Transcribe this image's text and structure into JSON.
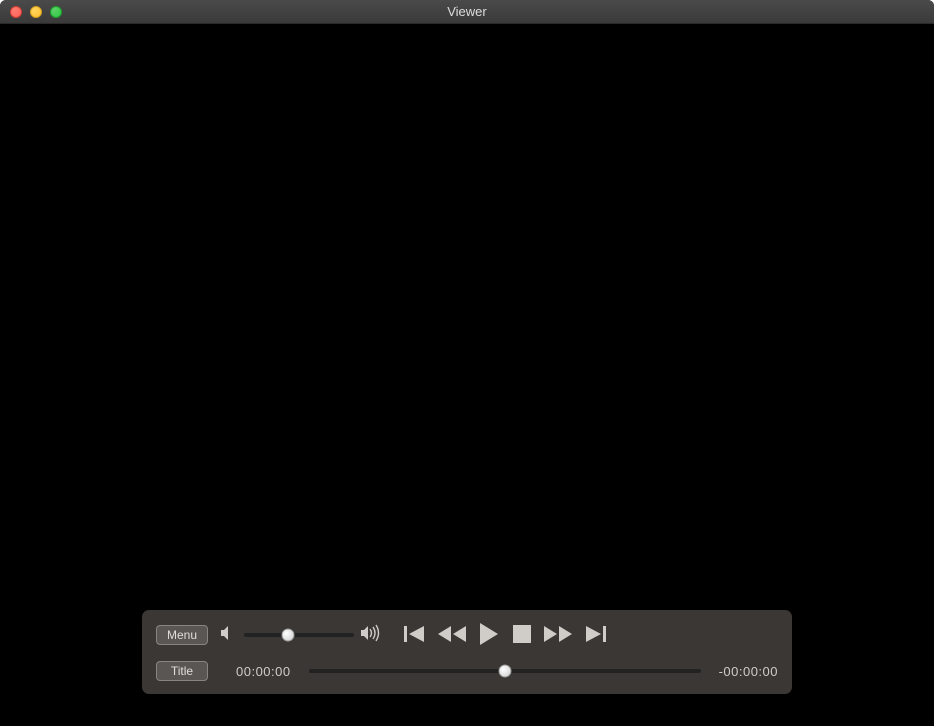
{
  "window": {
    "title": "Viewer"
  },
  "controller": {
    "menu_label": "Menu",
    "title_label": "Title",
    "time_elapsed": "00:00:00",
    "time_remaining": "-00:00:00"
  }
}
